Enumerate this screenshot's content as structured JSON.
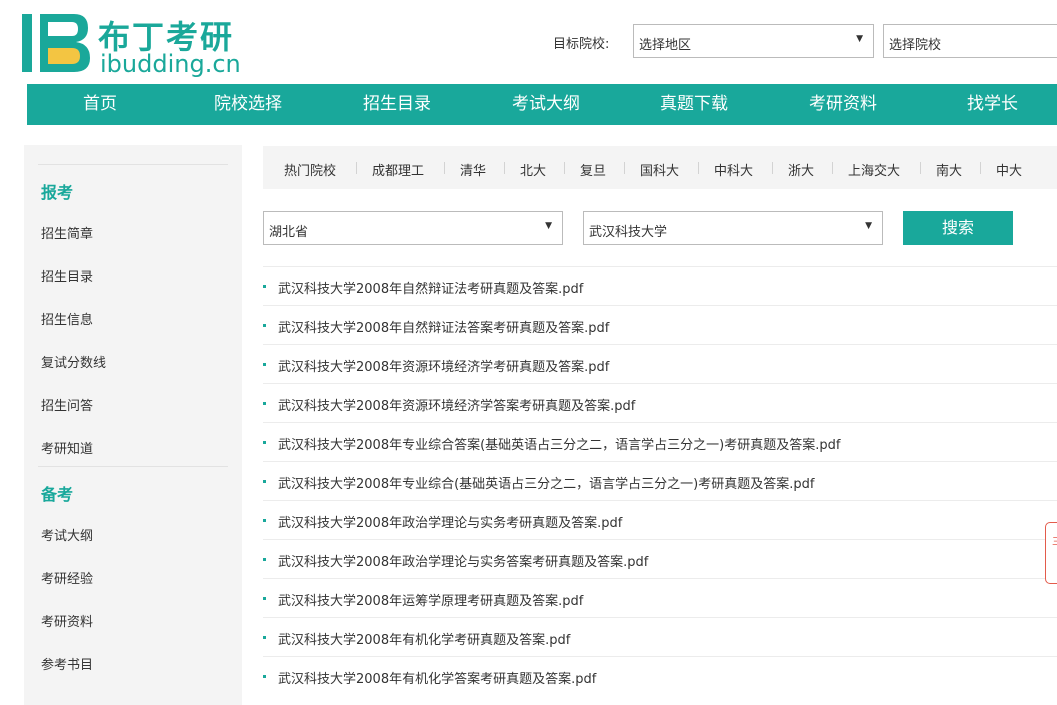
{
  "header": {
    "logo_cn": "布丁考研",
    "logo_en": "ibudding.cn",
    "target_label": "目标院校:",
    "region_select": "选择地区",
    "school_select": "选择院校"
  },
  "nav": [
    "首页",
    "院校选择",
    "招生目录",
    "考试大纲",
    "真题下载",
    "考研资料",
    "找学长"
  ],
  "sidebar": {
    "section1_title": "报考",
    "section1_items": [
      "招生简章",
      "招生目录",
      "招生信息",
      "复试分数线",
      "招生问答",
      "考研知道"
    ],
    "section2_title": "备考",
    "section2_items": [
      "考试大纲",
      "考研经验",
      "考研资料",
      "参考书目"
    ]
  },
  "hot_schools": [
    "热门院校",
    "成都理工",
    "清华",
    "北大",
    "复旦",
    "国科大",
    "中科大",
    "浙大",
    "上海交大",
    "南大",
    "中大"
  ],
  "filter": {
    "province": "湖北省",
    "university": "武汉科技大学",
    "search_label": "搜索"
  },
  "files": [
    "武汉科技大学2008年自然辩证法考研真题及答案.pdf",
    "武汉科技大学2008年自然辩证法答案考研真题及答案.pdf",
    "武汉科技大学2008年资源环境经济学考研真题及答案.pdf",
    "武汉科技大学2008年资源环境经济学答案考研真题及答案.pdf",
    "武汉科技大学2008年专业综合答案(基础英语占三分之二，语言学占三分之一)考研真题及答案.pdf",
    "武汉科技大学2008年专业综合(基础英语占三分之二，语言学占三分之一)考研真题及答案.pdf",
    "武汉科技大学2008年政治学理论与实务考研真题及答案.pdf",
    "武汉科技大学2008年政治学理论与实务答案考研真题及答案.pdf",
    "武汉科技大学2008年运筹学原理考研真题及答案.pdf",
    "武汉科技大学2008年有机化学考研真题及答案.pdf",
    "武汉科技大学2008年有机化学答案考研真题及答案.pdf"
  ],
  "widget_text": "三",
  "colors": {
    "accent": "#19a89b",
    "sidebar_bg": "#f4f4f4",
    "widget_border": "#e35b4b"
  }
}
